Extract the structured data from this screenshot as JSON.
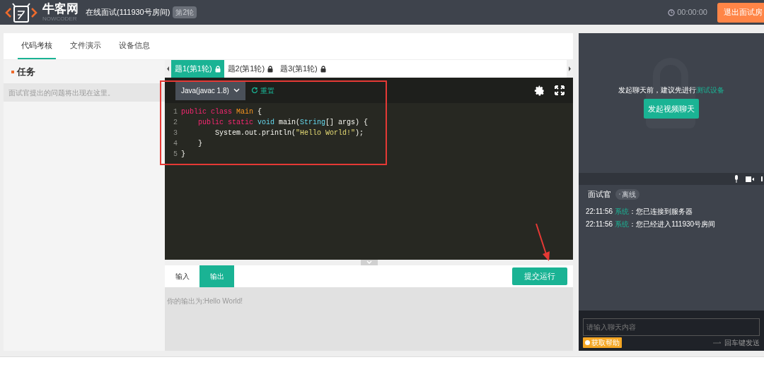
{
  "header": {
    "brand": "牛客网",
    "brand_sub": "NOWCODER",
    "title": "在线面试(111930号房间)",
    "round_badge": "第2轮",
    "timer": "00:00:00",
    "exit_button": "退出面试房"
  },
  "main_tabs": [
    {
      "label": "代码考核",
      "selected": true
    },
    {
      "label": "文件演示",
      "selected": false
    },
    {
      "label": "设备信息",
      "selected": false
    }
  ],
  "task": {
    "title": "任务",
    "hint": "面试官提出的问题将出现在这里。"
  },
  "question_tabs": [
    {
      "label": "题1(第1轮)",
      "selected": true,
      "locked": true
    },
    {
      "label": "题2(第1轮)",
      "selected": false,
      "locked": true
    },
    {
      "label": "题3(第1轮)",
      "selected": false,
      "locked": true
    }
  ],
  "editor": {
    "language": "Java(javac 1.8)",
    "reset": "重置",
    "lines": [
      {
        "number": "1",
        "tokens": [
          {
            "kind": "keyword",
            "text": "public class "
          },
          {
            "kind": "class",
            "text": "Main"
          },
          {
            "kind": "plain",
            "text": " {"
          }
        ]
      },
      {
        "number": "2",
        "tokens": [
          {
            "kind": "keyword",
            "text": "    public static "
          },
          {
            "kind": "type",
            "text": "void"
          },
          {
            "kind": "plain",
            "text": " main("
          },
          {
            "kind": "type",
            "text": "String"
          },
          {
            "kind": "plain",
            "text": "[] args) {"
          }
        ]
      },
      {
        "number": "3",
        "tokens": [
          {
            "kind": "plain",
            "text": "        System.out.println("
          },
          {
            "kind": "string",
            "text": "\"Hello World!\""
          },
          {
            "kind": "plain",
            "text": ");"
          }
        ]
      },
      {
        "number": "4",
        "tokens": [
          {
            "kind": "plain",
            "text": "    }"
          }
        ]
      },
      {
        "number": "5",
        "tokens": [
          {
            "kind": "plain",
            "text": "}"
          }
        ]
      }
    ]
  },
  "io_tabs": [
    {
      "label": "输入",
      "selected": false
    },
    {
      "label": "输出",
      "selected": true
    }
  ],
  "submit_button": "提交运行",
  "output": "你的输出为:Hello World!",
  "video": {
    "notice": "发起聊天前，建议先进行",
    "notice_link": "测试设备",
    "start_button": "发起视频聊天"
  },
  "interviewer": {
    "label": "面试官",
    "status": "离线"
  },
  "messages": [
    {
      "time": "22:11:56",
      "sender": "系统",
      "text": "：您已连接到服务器"
    },
    {
      "time": "22:11:56",
      "sender": "系统",
      "text": "：您已经进入111930号房间"
    }
  ],
  "chat": {
    "placeholder": "请输入聊天内容",
    "help_button": "获取帮助",
    "send_hint": "回车键发送"
  }
}
